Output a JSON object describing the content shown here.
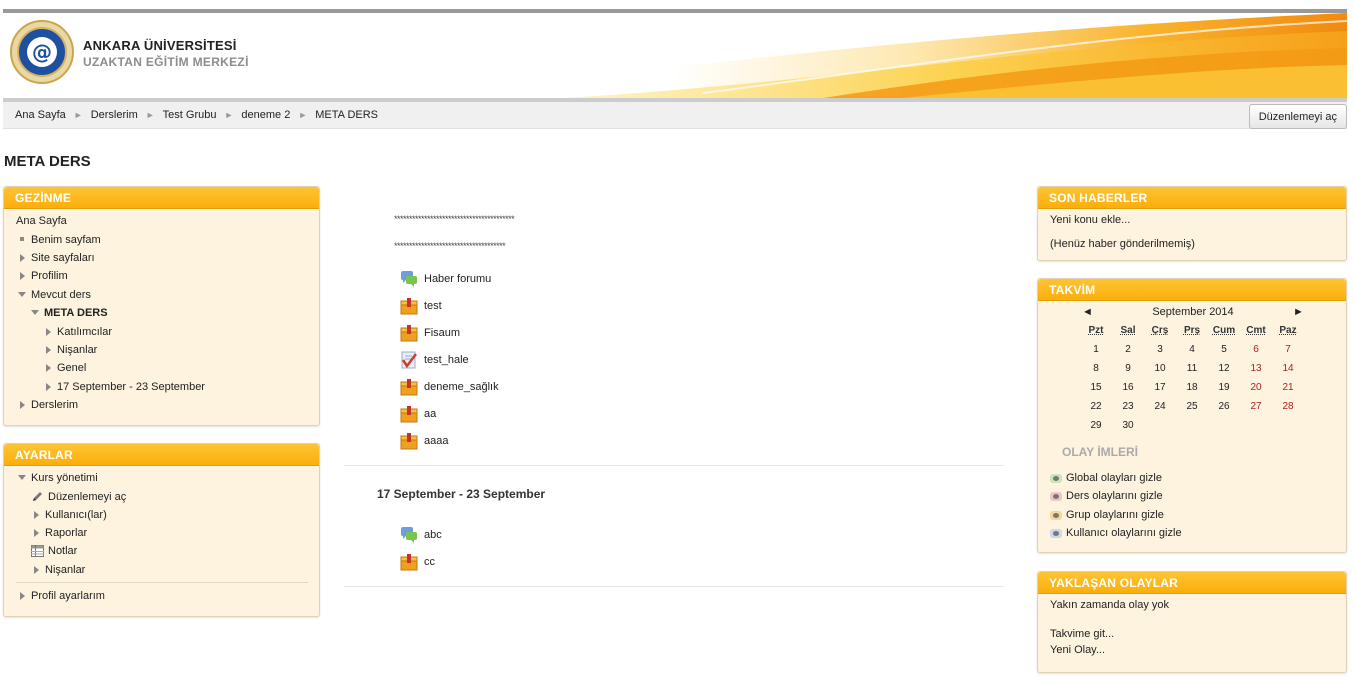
{
  "header": {
    "site_name": "ANKARA ÜNİVERSİTESİ",
    "site_subtitle": "UZAKTAN EĞİTİM MERKEZİ",
    "logo_icon": "university-seal-icon",
    "colors": {
      "orange": "#f7a21b",
      "yellow": "#fdd86a",
      "gray": "#999999"
    }
  },
  "breadcrumb": [
    "Ana Sayfa",
    "Derslerim",
    "Test Grubu",
    "deneme 2",
    "META DERS"
  ],
  "edit_button": "Düzenlemeyi aç",
  "page_title": "META DERS",
  "navigation": {
    "title": "GEZİNME",
    "home": "Ana Sayfa",
    "my_home": "Benim sayfam",
    "site_pages": "Site sayfaları",
    "profile": "Profilim",
    "current_course": "Mevcut ders",
    "course": "META DERS",
    "participants": "Katılımcılar",
    "badges": "Nişanlar",
    "general": "Genel",
    "week": "17 September - 23 September",
    "my_courses": "Derslerim"
  },
  "settings": {
    "title": "AYARLAR",
    "course_admin": "Kurs yönetimi",
    "turn_editing_on": "Düzenlemeyi aç",
    "users": "Kullanıcı(lar)",
    "reports": "Raporlar",
    "grades": "Notlar",
    "badges": "Nişanlar",
    "profile_settings": "Profil ayarlarım"
  },
  "main": {
    "stars1": "****************************************",
    "stars2": "*************************************",
    "activities": [
      {
        "label": "Haber forumu",
        "icon": "forum-icon"
      },
      {
        "label": "test",
        "icon": "package-icon"
      },
      {
        "label": "Fisaum",
        "icon": "package-icon"
      },
      {
        "label": "test_hale",
        "icon": "assignment-icon"
      },
      {
        "label": "deneme_sağlık",
        "icon": "package-icon"
      },
      {
        "label": "aa",
        "icon": "package-icon"
      },
      {
        "label": "aaaa",
        "icon": "package-icon"
      }
    ],
    "section_title": "17 September - 23 September",
    "section_activities": [
      {
        "label": "abc",
        "icon": "forum-icon"
      },
      {
        "label": "cc",
        "icon": "package-icon"
      }
    ]
  },
  "news": {
    "title": "SON HABERLER",
    "add_topic": "Yeni konu ekle...",
    "empty": "(Henüz haber gönderilmemiş)"
  },
  "calendar": {
    "title": "TAKVİM",
    "prev": "◄",
    "next": "►",
    "month": "September 2014",
    "days": [
      "Pzt",
      "Sal",
      "Çrş",
      "Prş",
      "Cum",
      "Cmt",
      "Paz"
    ],
    "weeks": [
      [
        "1",
        "2",
        "3",
        "4",
        "5",
        "6",
        "7"
      ],
      [
        "8",
        "9",
        "10",
        "11",
        "12",
        "13",
        "14"
      ],
      [
        "15",
        "16",
        "17",
        "18",
        "19",
        "20",
        "21"
      ],
      [
        "22",
        "23",
        "24",
        "25",
        "26",
        "27",
        "28"
      ],
      [
        "29",
        "30",
        "",
        "",
        "",
        "",
        ""
      ]
    ],
    "key_title": "OLAY İMLERİ",
    "keys": [
      {
        "label": "Global olayları gizle",
        "color": "#c8e6b8"
      },
      {
        "label": "Ders olaylarını gizle",
        "color": "#f3c4c4"
      },
      {
        "label": "Grup olaylarını gizle",
        "color": "#f5d79a"
      },
      {
        "label": "Kullanıcı olaylarını gizle",
        "color": "#cbd8ea"
      }
    ]
  },
  "upcoming": {
    "title": "YAKLAŞAN OLAYLAR",
    "none": "Yakın zamanda olay yok",
    "goto": "Takvime git...",
    "new_event": "Yeni Olay..."
  }
}
